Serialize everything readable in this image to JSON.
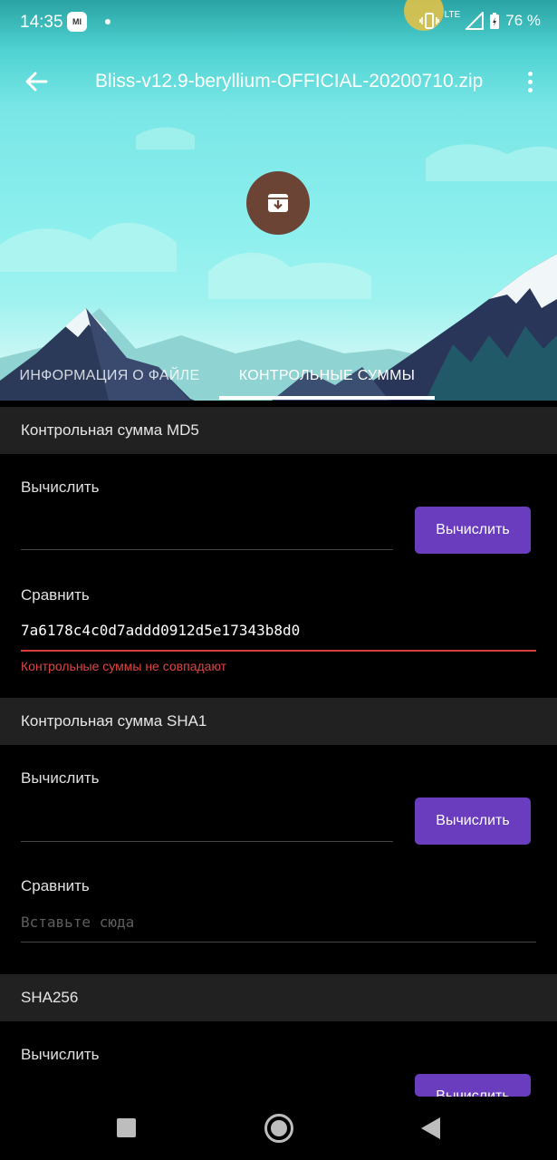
{
  "status_bar": {
    "time": "14:35",
    "notification_icon": "miui-app-icon",
    "network": "LTE",
    "battery": "76 %"
  },
  "toolbar": {
    "back_icon": "arrow-left-icon",
    "title": "Bliss-v12.9-beryllium-OFFICIAL-20200710.zip",
    "more_icon": "more-vert-icon"
  },
  "file_icon": "archive-icon",
  "tabs": [
    {
      "label": "ИНФОРМАЦИЯ О ФАЙЛЕ",
      "active": false
    },
    {
      "label": "КОНТРОЛЬНЫЕ СУММЫ",
      "active": true
    }
  ],
  "sections": [
    {
      "title": "Контрольная сумма MD5",
      "compute_label": "Вычислить",
      "compute_value": "",
      "compute_button": "Вычислить",
      "compare_label": "Сравнить",
      "compare_value": "7a6178c4c0d7addd0912d5e17343b8d0",
      "error": "Контрольные суммы не совпадают"
    },
    {
      "title": "Контрольная сумма SHA1",
      "compute_label": "Вычислить",
      "compute_value": "",
      "compute_button": "Вычислить",
      "compare_label": "Сравнить",
      "compare_placeholder": "Вставьте сюда"
    },
    {
      "title": "SHA256",
      "compute_label": "Вычислить",
      "compute_button": "Вычислить"
    }
  ],
  "colors": {
    "accent_button": "#6a3dbf",
    "error": "#e04444",
    "file_circle": "#6b4436",
    "sky": "#8ef0ee"
  },
  "nav_bar": {
    "recents_icon": "square-recents-icon",
    "home_icon": "circle-home-icon",
    "back_icon": "triangle-back-icon"
  }
}
